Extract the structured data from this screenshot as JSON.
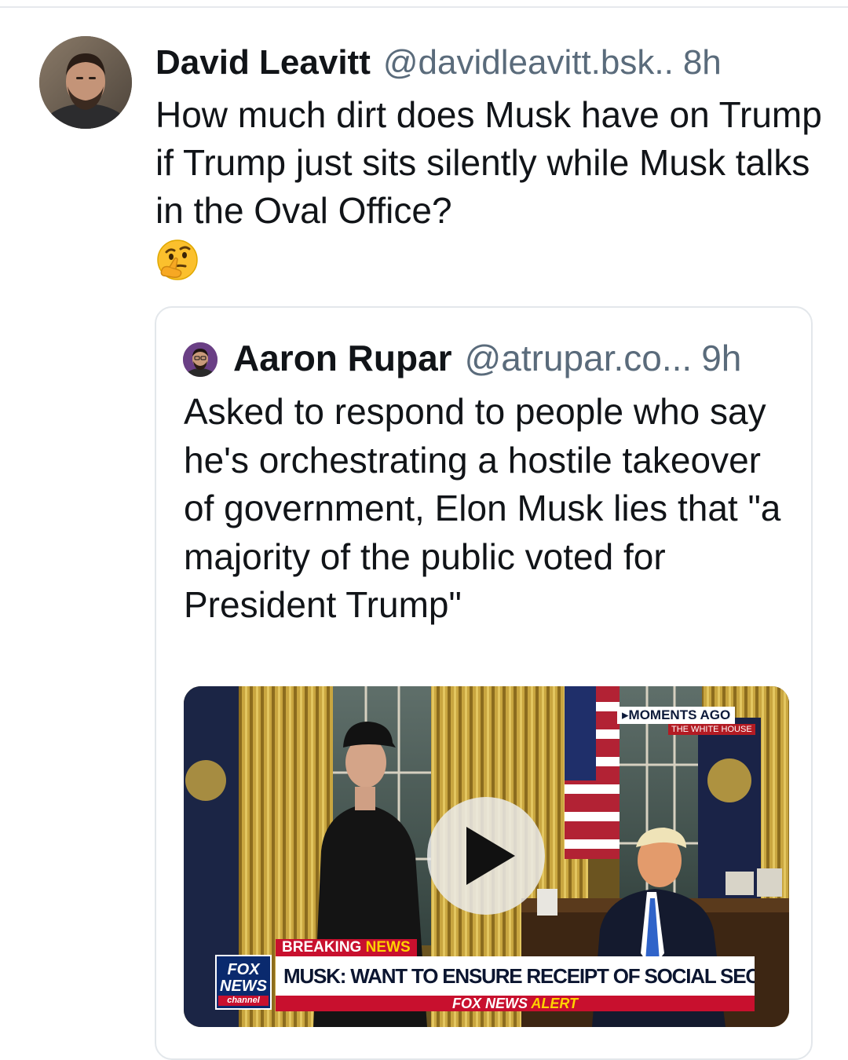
{
  "post": {
    "author_name": "David Leavitt",
    "author_handle": "@davidleavitt.bsk..",
    "time": "8h",
    "text": "How much dirt does Musk have on Trump if Trump just sits silently while Musk talks in the Oval Office?",
    "emoji": "thinking-face"
  },
  "quote": {
    "author_name": "Aaron Rupar",
    "author_handle": "@atrupar.co...",
    "time": "9h",
    "text": "Asked to respond to people who say he's orchestrating a hostile takeover of government, Elon Musk lies that \"a majority of the public voted for President Trump\"",
    "video": {
      "bug_label": "▸MOMENTS AGO",
      "bug_location": "THE WHITE HOUSE",
      "breaking_prefix": "BREAKING",
      "breaking_suffix": "NEWS",
      "headline": "MUSK: WANT TO ENSURE RECEIPT OF SOCIAL SECURITY",
      "alert_prefix": "FOX NEWS",
      "alert_suffix": "ALERT",
      "logo_line1": "FOX",
      "logo_line2": "NEWS",
      "logo_line3": "channel",
      "play_icon": "play-icon"
    }
  }
}
